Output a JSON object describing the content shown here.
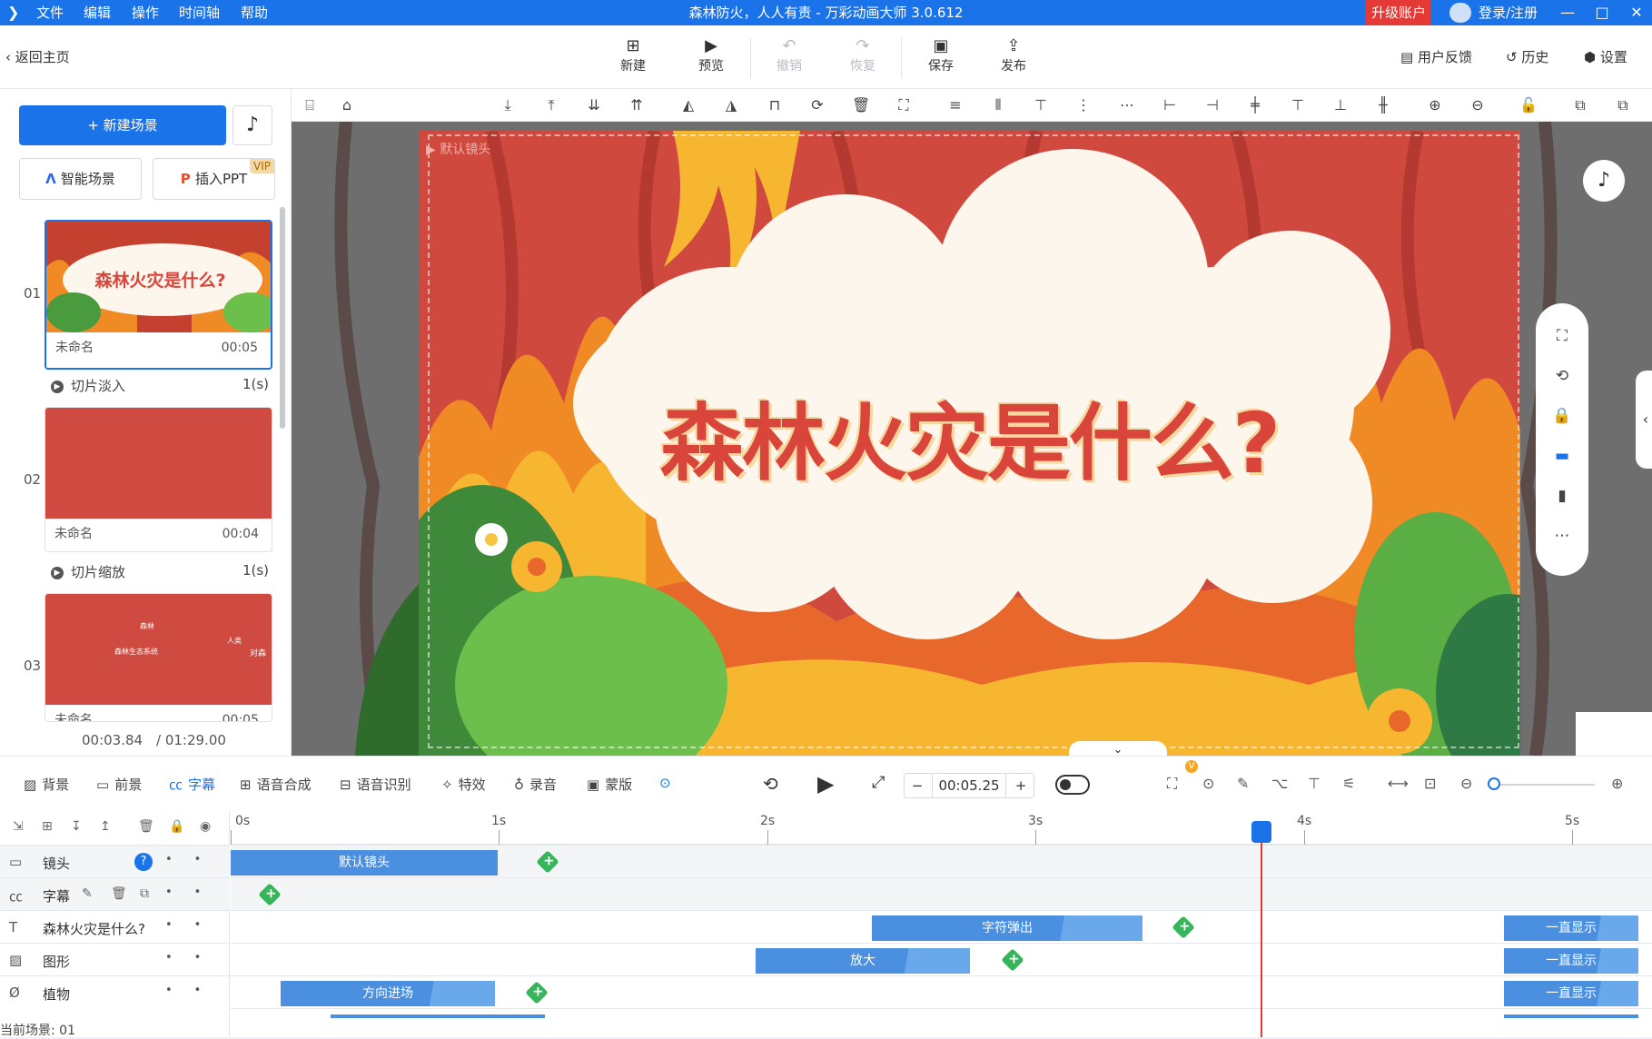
{
  "menu": {
    "items": [
      "文件",
      "编辑",
      "操作",
      "时间轴",
      "帮助"
    ]
  },
  "app_title": "森林防火，人人有责 - 万彩动画大师 3.0.612",
  "account": {
    "upgrade": "升级账户",
    "login": "登录/注册"
  },
  "window": {
    "minimize": "—",
    "maximize": "□",
    "close": "✕"
  },
  "toolbar": {
    "back": "返回主页",
    "buttons": [
      {
        "label": "新建",
        "icon": "plus-square-icon",
        "enabled": true
      },
      {
        "label": "预览",
        "icon": "play-icon",
        "enabled": true
      },
      {
        "label": "撤销",
        "icon": "undo-icon",
        "enabled": false
      },
      {
        "label": "恢复",
        "icon": "redo-icon",
        "enabled": false
      },
      {
        "label": "保存",
        "icon": "save-icon",
        "enabled": true
      },
      {
        "label": "发布",
        "icon": "publish-icon",
        "enabled": true
      }
    ],
    "right": [
      {
        "label": "用户反馈",
        "icon": "feedback-icon"
      },
      {
        "label": "历史",
        "icon": "history-icon"
      },
      {
        "label": "设置",
        "icon": "gear-icon"
      }
    ]
  },
  "sidebar": {
    "new_scene": "+ 新建场景",
    "smart_scene": "智能场景",
    "insert_ppt": "插入PPT",
    "vip": "VIP",
    "scenes": [
      {
        "num": "01",
        "name": "未命名",
        "duration": "00:05",
        "thumb_title": "森林火灾是什么?",
        "active": true
      },
      {
        "num": "02",
        "name": "未命名",
        "duration": "00:04",
        "active": false
      },
      {
        "num": "03",
        "name": "未命名",
        "duration": "00:05",
        "active": false
      }
    ],
    "transitions": [
      {
        "name": "切片淡入",
        "time": "1(s)"
      },
      {
        "name": "切片缩放",
        "time": "1(s)"
      }
    ],
    "thumb3_texts": [
      "森林",
      "人类",
      "森林生态系统",
      "对森"
    ],
    "time_current": "00:03.84",
    "time_total": "/ 01:29.00"
  },
  "stage": {
    "camera_label": "默认镜头",
    "headline": "森林火灾是什么?",
    "colors": {
      "bg": "#d0493f",
      "cloud": "#fdf6ec",
      "text": "#d9453b"
    }
  },
  "timeline_tools": {
    "items": [
      {
        "label": "背景",
        "icon": "background-icon"
      },
      {
        "label": "前景",
        "icon": "foreground-icon"
      },
      {
        "label": "字幕",
        "icon": "caption-icon",
        "active": true
      },
      {
        "label": "语音合成",
        "icon": "tts-icon"
      },
      {
        "label": "语音识别",
        "icon": "asr-icon"
      },
      {
        "label": "特效",
        "icon": "effects-icon"
      },
      {
        "label": "录音",
        "icon": "mic-icon"
      },
      {
        "label": "蒙版",
        "icon": "mask-icon"
      }
    ],
    "time_value": "00:05.25",
    "badge": "V"
  },
  "timeline": {
    "ruler": [
      "0s",
      "1s",
      "2s",
      "3s",
      "4s",
      "5s"
    ],
    "tracks": [
      {
        "label": "镜头",
        "icon": "camera-icon"
      },
      {
        "label": "字幕",
        "icon": "caption-icon"
      },
      {
        "label": "森林火灾是什么?",
        "icon": "text-icon"
      },
      {
        "label": "图形",
        "icon": "image-icon"
      },
      {
        "label": "植物",
        "icon": "plant-icon"
      }
    ],
    "clips": {
      "camera": "默认镜头",
      "title_in": "字符弹出",
      "title_always": "一直显示",
      "shape_in": "放大",
      "shape_always": "一直显示",
      "plant_in": "方向进场",
      "plant_always": "一直显示"
    },
    "current_scene": "当前场景: 01"
  }
}
